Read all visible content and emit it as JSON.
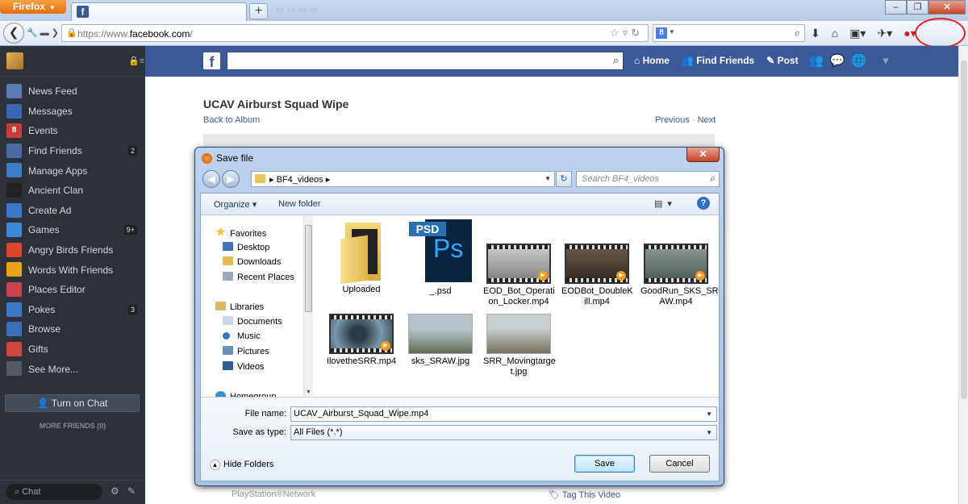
{
  "browser": {
    "menu_button": "Firefox",
    "url_prefix": "https://www.",
    "url_domain": "facebook.com",
    "url_suffix": "/",
    "search_engine_icon": "google-icon"
  },
  "sidebar": {
    "items": [
      {
        "label": "News Feed",
        "icon": "news-feed-icon",
        "color": "#5b7bb4",
        "badge": ""
      },
      {
        "label": "Messages",
        "icon": "messages-icon",
        "color": "#3b67b2",
        "badge": ""
      },
      {
        "label": "Events",
        "icon": "events-icon",
        "color": "#c73b3b",
        "badge": "",
        "glyph": "8"
      },
      {
        "label": "Find Friends",
        "icon": "find-friends-icon",
        "color": "#4a6aa5",
        "badge": "2"
      },
      {
        "label": "Manage Apps",
        "icon": "manage-apps-icon",
        "color": "#3d7bc7",
        "badge": ""
      },
      {
        "label": "Ancient Clan",
        "icon": "ancient-clan-icon",
        "color": "#222222",
        "badge": ""
      },
      {
        "label": "Create Ad",
        "icon": "create-ad-icon",
        "color": "#3f77c8",
        "badge": ""
      },
      {
        "label": "Games",
        "icon": "games-icon",
        "color": "#3b8bd6",
        "badge": "9+"
      },
      {
        "label": "Angry Birds Friends",
        "icon": "angry-birds-icon",
        "color": "#d8452b",
        "badge": ""
      },
      {
        "label": "Words With Friends",
        "icon": "words-with-friends-icon",
        "color": "#e8a319",
        "badge": ""
      },
      {
        "label": "Places Editor",
        "icon": "places-editor-icon",
        "color": "#c8434f",
        "badge": ""
      },
      {
        "label": "Pokes",
        "icon": "pokes-icon",
        "color": "#3f77c8",
        "badge": "3"
      },
      {
        "label": "Browse",
        "icon": "browse-icon",
        "color": "#3d6fb6",
        "badge": ""
      },
      {
        "label": "Gifts",
        "icon": "gifts-icon",
        "color": "#d0453c",
        "badge": ""
      },
      {
        "label": "See More...",
        "icon": "see-more-icon",
        "color": "#555b66",
        "badge": ""
      }
    ],
    "chat_button": "Turn on Chat",
    "more_friends": "MORE FRIENDS (0)",
    "chat_search": "Chat"
  },
  "fb_header": {
    "nav": [
      "Home",
      "Find Friends",
      "Post"
    ]
  },
  "page": {
    "title": "UCAV Airburst Squad Wipe",
    "back_link": "Back to Album",
    "previous": "Previous",
    "separator": "·",
    "next": "Next",
    "footer_left": "PlayStation®Network",
    "footer_right": "Tag This Video"
  },
  "dialog": {
    "title": "Save file",
    "path": "BF4_videos",
    "search_placeholder": "Search BF4_videos",
    "organize": "Organize",
    "new_folder": "New folder",
    "nav": {
      "favorites": "Favorites",
      "desktop": "Desktop",
      "downloads": "Downloads",
      "recent_places": "Recent Places",
      "libraries": "Libraries",
      "documents": "Documents",
      "music": "Music",
      "pictures": "Pictures",
      "videos": "Videos",
      "homegroup": "Homegroup"
    },
    "files": [
      {
        "name": "Uploaded",
        "kind": "folder"
      },
      {
        "name": "_.psd",
        "kind": "psd"
      },
      {
        "name": "EOD_Bot_Operation_Locker.mp4",
        "kind": "video",
        "line1": "EOD_Bot_Operati",
        "line2": "on_Locker.mp4"
      },
      {
        "name": "EODBot_DoubleKill.mp4",
        "kind": "video",
        "line1": "EODBot_DoubleK",
        "line2": "ill.mp4"
      },
      {
        "name": "GoodRun_SKS_SRAW.mp4",
        "kind": "video",
        "line1": "GoodRun_SKS_SR",
        "line2": "AW.mp4"
      },
      {
        "name": "IlovetheSRR.mp4",
        "kind": "video",
        "line1": "IlovetheSRR.mp4",
        "line2": ""
      },
      {
        "name": "sks_SRAW.jpg",
        "kind": "image",
        "line1": "sks_SRAW.jpg",
        "line2": ""
      },
      {
        "name": "SRR_Movingtarget.jpg",
        "kind": "image",
        "line1": "SRR_Movingtarge",
        "line2": "t.jpg"
      }
    ],
    "file_name_label": "File name:",
    "file_name_value": "UCAV_Airburst_Squad_Wipe.mp4",
    "save_type_label": "Save as type:",
    "save_type_value": "All Files (*.*)",
    "hide_folders": "Hide Folders",
    "save": "Save",
    "cancel": "Cancel"
  },
  "colors": {
    "facebook_blue": "#3b5998",
    "sidebar_bg": "#2d3139",
    "annotation_red": "#dd2222"
  }
}
